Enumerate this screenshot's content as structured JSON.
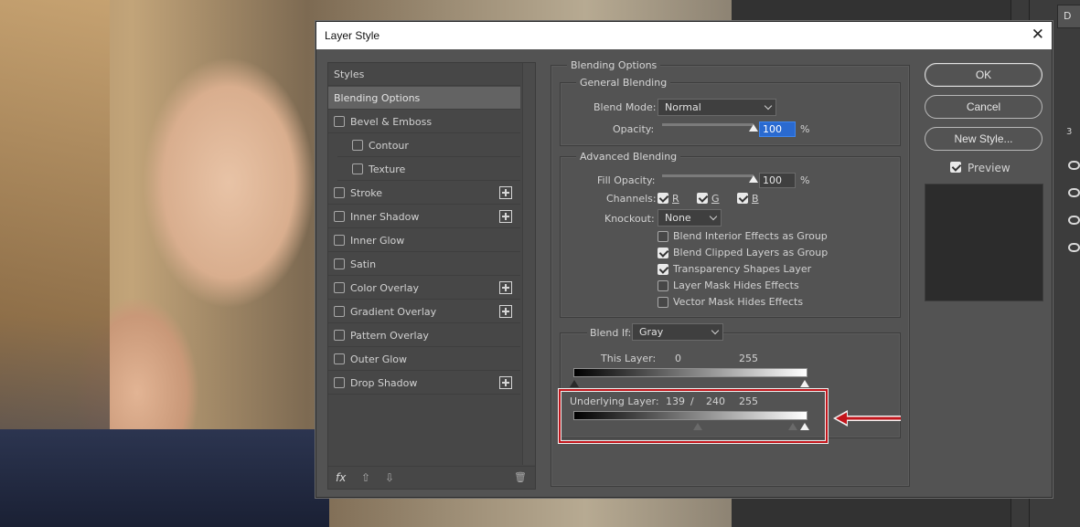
{
  "dialog": {
    "title": "Layer Style",
    "close_glyph": "✕"
  },
  "styles_panel": {
    "items": [
      {
        "label": "Styles",
        "selected": false,
        "checkbox": false,
        "plus": false,
        "indent": 0
      },
      {
        "label": "Blending Options",
        "selected": true,
        "checkbox": false,
        "plus": false,
        "indent": 0
      },
      {
        "label": "Bevel & Emboss",
        "selected": false,
        "checkbox": true,
        "plus": false,
        "indent": 0
      },
      {
        "label": "Contour",
        "selected": false,
        "checkbox": true,
        "plus": false,
        "indent": 1
      },
      {
        "label": "Texture",
        "selected": false,
        "checkbox": true,
        "plus": false,
        "indent": 1
      },
      {
        "label": "Stroke",
        "selected": false,
        "checkbox": true,
        "plus": true,
        "indent": 0
      },
      {
        "label": "Inner Shadow",
        "selected": false,
        "checkbox": true,
        "plus": true,
        "indent": 0
      },
      {
        "label": "Inner Glow",
        "selected": false,
        "checkbox": true,
        "plus": false,
        "indent": 0
      },
      {
        "label": "Satin",
        "selected": false,
        "checkbox": true,
        "plus": false,
        "indent": 0
      },
      {
        "label": "Color Overlay",
        "selected": false,
        "checkbox": true,
        "plus": true,
        "indent": 0
      },
      {
        "label": "Gradient Overlay",
        "selected": false,
        "checkbox": true,
        "plus": true,
        "indent": 0
      },
      {
        "label": "Pattern Overlay",
        "selected": false,
        "checkbox": true,
        "plus": false,
        "indent": 0
      },
      {
        "label": "Outer Glow",
        "selected": false,
        "checkbox": true,
        "plus": false,
        "indent": 0
      },
      {
        "label": "Drop Shadow",
        "selected": false,
        "checkbox": true,
        "plus": true,
        "indent": 0
      }
    ],
    "footer": {
      "fx": "fx",
      "up": "⇧",
      "down": "⇩",
      "trash": "🗑"
    }
  },
  "blending_options": {
    "section_title": "Blending Options",
    "general": {
      "title": "General Blending",
      "blend_mode_label": "Blend Mode:",
      "blend_mode_value": "Normal",
      "opacity_label": "Opacity:",
      "opacity_value": "100",
      "opacity_unit": "%",
      "opacity_fraction": 1.0
    },
    "advanced": {
      "title": "Advanced Blending",
      "fill_opacity_label": "Fill Opacity:",
      "fill_opacity_value": "100",
      "fill_opacity_unit": "%",
      "fill_opacity_fraction": 1.0,
      "channels_label": "Channels:",
      "channels": [
        {
          "label": "R",
          "checked": true
        },
        {
          "label": "G",
          "checked": true
        },
        {
          "label": "B",
          "checked": true
        }
      ],
      "knockout_label": "Knockout:",
      "knockout_value": "None",
      "options": [
        {
          "label": "Blend Interior Effects as Group",
          "checked": false
        },
        {
          "label": "Blend Clipped Layers as Group",
          "checked": true
        },
        {
          "label": "Transparency Shapes Layer",
          "checked": true
        },
        {
          "label": "Layer Mask Hides Effects",
          "checked": false
        },
        {
          "label": "Vector Mask Hides Effects",
          "checked": false
        }
      ]
    },
    "blend_if": {
      "label": "Blend If:",
      "value": "Gray",
      "this_layer": {
        "label": "This Layer:",
        "low": "0",
        "high": "255"
      },
      "underlying_layer": {
        "label": "Underlying Layer:",
        "low": "139",
        "separator": "/",
        "mid": "240",
        "high": "255"
      }
    }
  },
  "buttons": {
    "ok": "OK",
    "cancel": "Cancel",
    "new_style": "New Style...",
    "preview_label": "Preview",
    "preview_checked": true
  },
  "annotation": {
    "highlight_color": "#c2151b",
    "arrow_color": "#c2151b"
  },
  "right_dock": {
    "tab_label": "D",
    "layer_number": "3"
  }
}
